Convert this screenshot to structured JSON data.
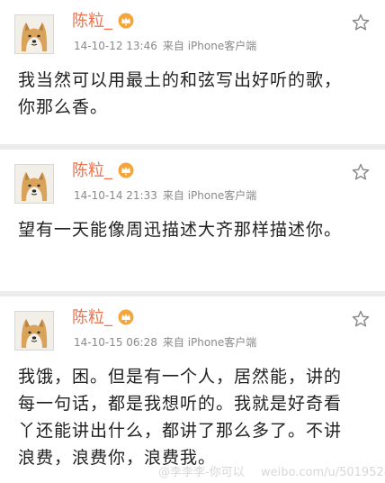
{
  "posts": [
    {
      "author": "陈粒_",
      "timestamp": "14-10-12 13:46",
      "source_prefix": "来自",
      "source": "iPhone客户端",
      "text": "我当然可以用最土的和弦写出好听的歌，你那么香。"
    },
    {
      "author": "陈粒_",
      "timestamp": "14-10-14 21:33",
      "source_prefix": "来自",
      "source": "iPhone客户端",
      "text": "望有一天能像周迅描述大齐那样描述你。"
    },
    {
      "author": "陈粒_",
      "timestamp": "14-10-15 06:28",
      "source_prefix": "来自",
      "source": "iPhone客户端",
      "text": "我饿，困。但是有一个人，居然能，讲的每一句话，都是我想听的。我就是好奇看丫还能讲出什么，都讲了那么多了。不讲浪费，浪费你，浪费我。"
    }
  ],
  "icons": {
    "avatar": "shiba-dog-avatar",
    "badge": "vip-crown-icon",
    "favorite": "star-outline-icon"
  },
  "colors": {
    "author": "#eb7350",
    "meta": "#8a8a8a",
    "body_text": "#222222",
    "background": "#ececec",
    "card": "#ffffff"
  },
  "watermark": {
    "left": "@李李李-你可以",
    "right": "weibo.com/u/5019528112"
  }
}
